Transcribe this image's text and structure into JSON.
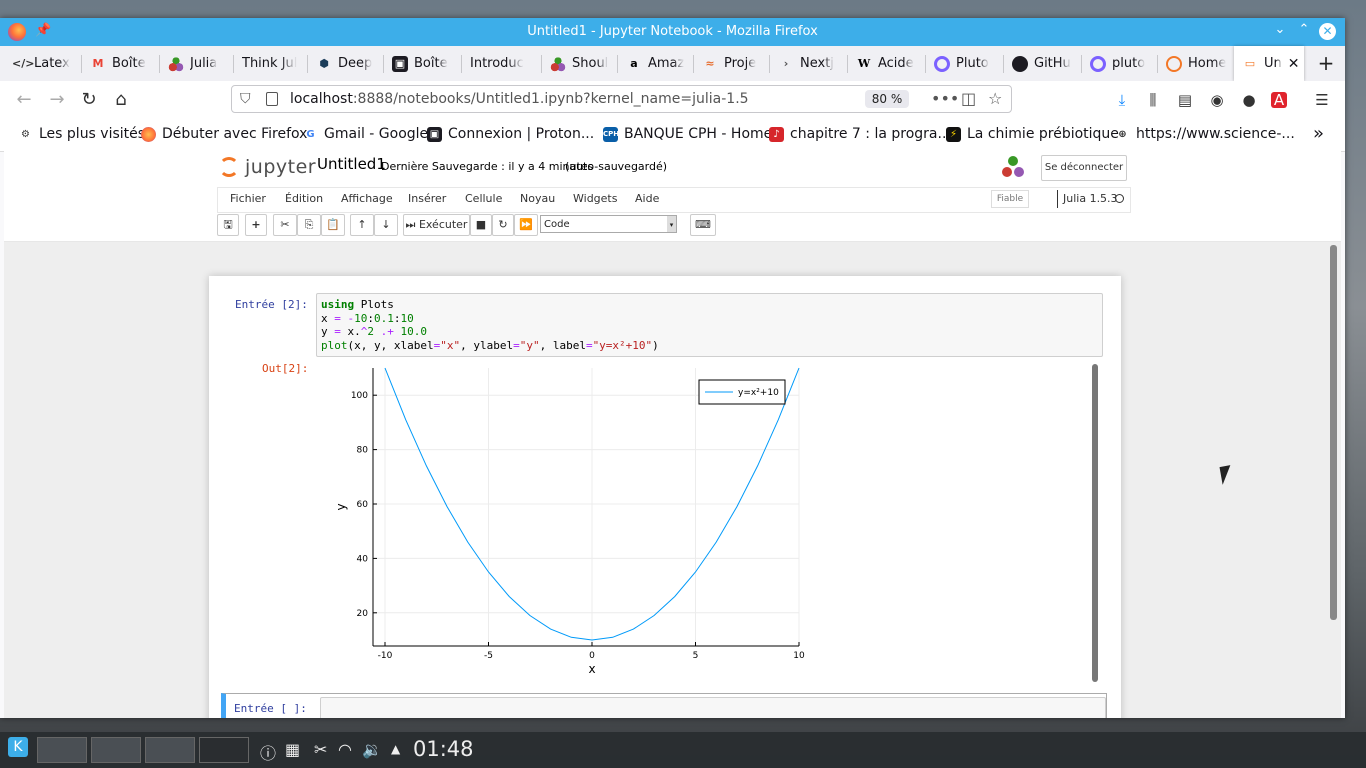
{
  "window": {
    "title": "Untitled1 - Jupyter Notebook - Mozilla Firefox"
  },
  "tabs": [
    {
      "label": "Latex",
      "icon": "code-icon"
    },
    {
      "label": "Boîte",
      "icon": "gmail-icon"
    },
    {
      "label": "Julia",
      "icon": "julia-icon"
    },
    {
      "label": "Think Jul",
      "icon": ""
    },
    {
      "label": "Deep",
      "icon": "deep-icon"
    },
    {
      "label": "Boîte",
      "icon": "proton-icon"
    },
    {
      "label": "Introduc",
      "icon": ""
    },
    {
      "label": "Shoul",
      "icon": "julia-icon"
    },
    {
      "label": "Amaz",
      "icon": "amazon-icon"
    },
    {
      "label": "Proje",
      "icon": "project-icon"
    },
    {
      "label": "Nextj",
      "icon": "chevron-icon"
    },
    {
      "label": "Acide",
      "icon": "wikipedia-icon"
    },
    {
      "label": "Pluto",
      "icon": "pluto-icon"
    },
    {
      "label": "GitHu",
      "icon": "github-icon"
    },
    {
      "label": "pluto",
      "icon": "pluto-icon"
    },
    {
      "label": "Home",
      "icon": "jupyter-icon"
    },
    {
      "label": "Un",
      "icon": "notebook-icon",
      "active": true
    }
  ],
  "navbar": {
    "url_host": "localhost",
    "url_rest": ":8888/notebooks/Untitled1.ipynb?kernel_name=julia-1.5",
    "zoom": "80 %"
  },
  "bookmarks": [
    {
      "label": "Les plus visités"
    },
    {
      "label": "Débuter avec Firefox"
    },
    {
      "label": "Gmail - Google"
    },
    {
      "label": "Connexion | Proton..."
    },
    {
      "label": "BANQUE CPH - Home"
    },
    {
      "label": "chapitre 7 : la progra..."
    },
    {
      "label": "La chimie prébiotique"
    },
    {
      "label": "https://www.science-..."
    }
  ],
  "jupyter": {
    "logo": "jupyter",
    "notebook_name": "Untitled1",
    "save_status": "Dernière Sauvegarde : il y a 4 minutes",
    "autosave": "(auto-sauvegardé)",
    "logout": "Se déconnecter",
    "menu": [
      "Fichier",
      "Édition",
      "Affichage",
      "Insérer",
      "Cellule",
      "Noyau",
      "Widgets",
      "Aide"
    ],
    "trusted": "Fiable",
    "kernel": "Julia 1.5.3",
    "run_label": "Exécuter",
    "cell_type": "Code"
  },
  "cells": [
    {
      "prompt_in": "Entrée [2]:",
      "prompt_out": "Out[2]:",
      "code": [
        "using Plots",
        "x = -10:0.1:10",
        "y = x.^2 .+ 10.0",
        "plot(x, y, xlabel=\"x\", ylabel=\"y\", label=\"y=x²+10\")"
      ]
    },
    {
      "prompt_in": "Entrée [ ]:"
    }
  ],
  "chart_data": {
    "type": "line",
    "xlabel": "x",
    "ylabel": "y",
    "xlim": [
      -10,
      10
    ],
    "ylim": [
      10,
      110
    ],
    "xticks": [
      -10,
      -5,
      0,
      5,
      10
    ],
    "yticks": [
      20,
      40,
      60,
      80,
      100
    ],
    "grid": true,
    "legend_position": "top-right",
    "series": [
      {
        "name": "y=x²+10",
        "color": "#009af9",
        "x": [
          -10,
          -9,
          -8,
          -7,
          -6,
          -5,
          -4,
          -3,
          -2,
          -1,
          0,
          1,
          2,
          3,
          4,
          5,
          6,
          7,
          8,
          9,
          10
        ],
        "y": [
          110,
          91,
          74,
          59,
          46,
          35,
          26,
          19,
          14,
          11,
          10,
          11,
          14,
          19,
          26,
          35,
          46,
          59,
          74,
          91,
          110
        ]
      }
    ]
  },
  "taskbar": {
    "clock": "01:48"
  },
  "colors": {
    "titlebar": "#3daee9",
    "jupyter_orange": "#f37726",
    "selected_cell": "#42a5f5"
  }
}
